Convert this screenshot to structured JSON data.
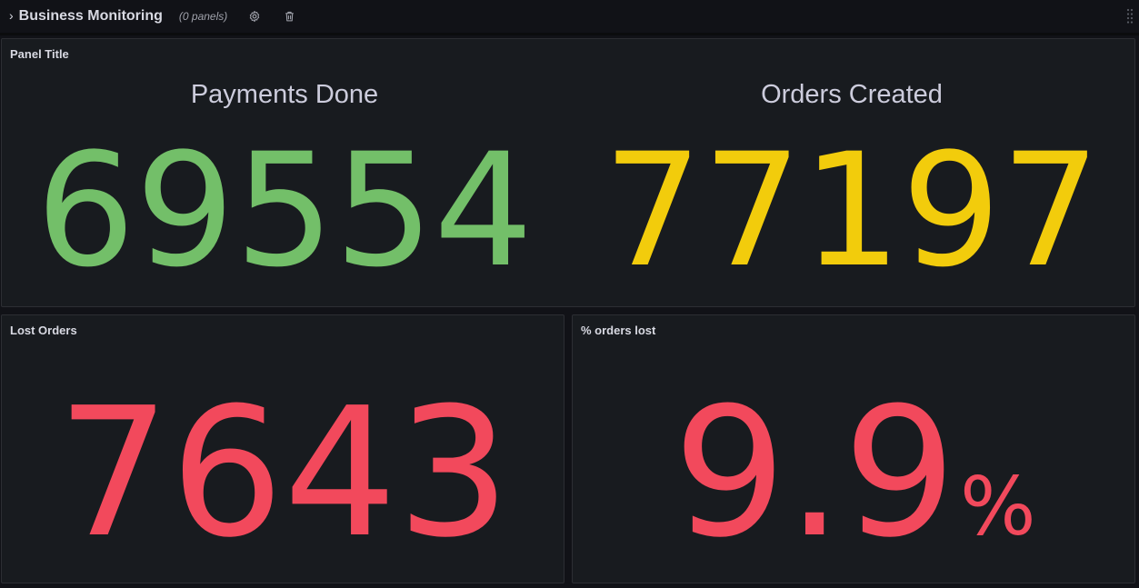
{
  "row": {
    "title": "Business Monitoring",
    "panel_count": "(0 panels)"
  },
  "panels": {
    "top": {
      "title": "Panel Title",
      "stats": [
        {
          "label": "Payments Done",
          "value": "69554",
          "color": "#73bf69"
        },
        {
          "label": "Orders Created",
          "value": "77197",
          "color": "#f2cc0c"
        }
      ]
    },
    "lost_orders": {
      "title": "Lost Orders",
      "value": "7643",
      "color": "#f2495c"
    },
    "percent_lost": {
      "title": "% orders lost",
      "value": "9.9",
      "unit": "%",
      "color": "#f2495c"
    }
  },
  "icons": {
    "chevron": "chevron-right-icon",
    "settings": "gear-icon",
    "delete": "trash-icon",
    "drag": "drag-handle-icon"
  }
}
